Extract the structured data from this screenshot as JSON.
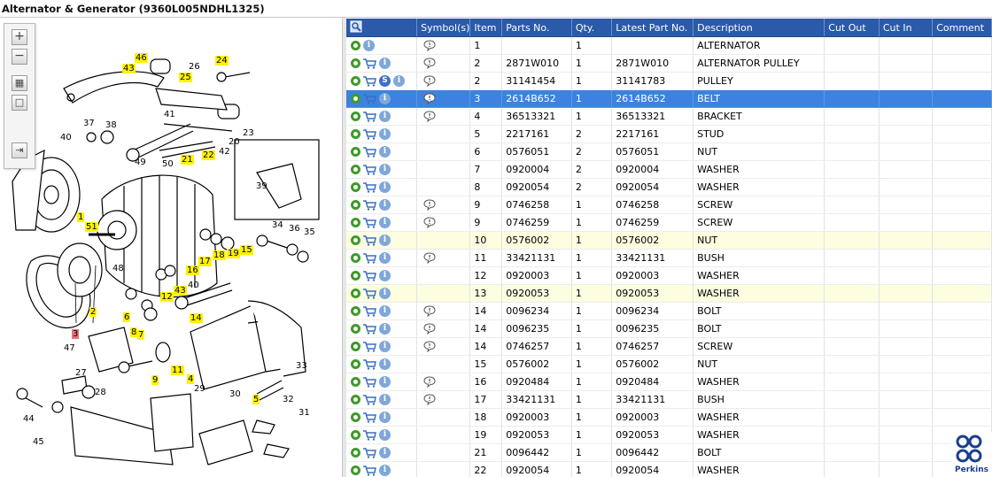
{
  "window": {
    "title": "Alternator & Generator (9360L005NDHL1325)"
  },
  "toolbar": {
    "zoom_in": "+",
    "zoom_out": "−",
    "fit": "▦",
    "actual": "□",
    "export": "⇥"
  },
  "callouts": [
    {
      "text": "46",
      "style": "hl"
    },
    {
      "text": "43",
      "style": "hl"
    },
    {
      "text": "26",
      "style": ""
    },
    {
      "text": "24",
      "style": "hl"
    },
    {
      "text": "25",
      "style": "hl"
    },
    {
      "text": "41",
      "style": ""
    },
    {
      "text": "37",
      "style": ""
    },
    {
      "text": "38",
      "style": ""
    },
    {
      "text": "40",
      "style": ""
    },
    {
      "text": "49",
      "style": ""
    },
    {
      "text": "50",
      "style": ""
    },
    {
      "text": "21",
      "style": "hl"
    },
    {
      "text": "22",
      "style": "hl"
    },
    {
      "text": "42",
      "style": ""
    },
    {
      "text": "20",
      "style": ""
    },
    {
      "text": "23",
      "style": ""
    },
    {
      "text": "39",
      "style": ""
    },
    {
      "text": "1",
      "style": "hl"
    },
    {
      "text": "51",
      "style": "hl"
    },
    {
      "text": "34",
      "style": ""
    },
    {
      "text": "36",
      "style": ""
    },
    {
      "text": "35",
      "style": ""
    },
    {
      "text": "18",
      "style": "hl"
    },
    {
      "text": "19",
      "style": "hl"
    },
    {
      "text": "15",
      "style": "hl"
    },
    {
      "text": "17",
      "style": "hl"
    },
    {
      "text": "16",
      "style": "hl"
    },
    {
      "text": "40",
      "style": ""
    },
    {
      "text": "48",
      "style": ""
    },
    {
      "text": "43",
      "style": "hl"
    },
    {
      "text": "12",
      "style": "hl"
    },
    {
      "text": "2",
      "style": "hl"
    },
    {
      "text": "14",
      "style": "hl"
    },
    {
      "text": "6",
      "style": "hl"
    },
    {
      "text": "8",
      "style": "hl"
    },
    {
      "text": "7",
      "style": "hl"
    },
    {
      "text": "3",
      "style": "sel"
    },
    {
      "text": "47",
      "style": ""
    },
    {
      "text": "33",
      "style": ""
    },
    {
      "text": "11",
      "style": "hl"
    },
    {
      "text": "9",
      "style": "hl"
    },
    {
      "text": "4",
      "style": "hl"
    },
    {
      "text": "27",
      "style": ""
    },
    {
      "text": "28",
      "style": ""
    },
    {
      "text": "29",
      "style": ""
    },
    {
      "text": "30",
      "style": ""
    },
    {
      "text": "5",
      "style": "hl"
    },
    {
      "text": "32",
      "style": ""
    },
    {
      "text": "44",
      "style": ""
    },
    {
      "text": "45",
      "style": ""
    },
    {
      "text": "31",
      "style": ""
    }
  ],
  "columns": [
    "",
    "Symbol(s)",
    "Item",
    "Parts No.",
    "Qty.",
    "Latest Part No.",
    "Description",
    "Cut Out",
    "Cut In",
    "Comment"
  ],
  "rows": [
    {
      "cart": false,
      "s": false,
      "note": true,
      "item": "1",
      "part": "",
      "qty": "1",
      "latest": "",
      "desc": "ALTERNATOR",
      "state": ""
    },
    {
      "cart": true,
      "s": false,
      "note": true,
      "item": "2",
      "part": "2871W010",
      "qty": "1",
      "latest": "2871W010",
      "desc": "ALTERNATOR PULLEY",
      "state": ""
    },
    {
      "cart": true,
      "s": true,
      "note": true,
      "item": "2",
      "part": "31141454",
      "qty": "1",
      "latest": "31141783",
      "desc": "PULLEY",
      "state": ""
    },
    {
      "cart": true,
      "s": false,
      "note": true,
      "item": "3",
      "part": "2614B652",
      "qty": "1",
      "latest": "2614B652",
      "desc": "BELT",
      "state": "sel"
    },
    {
      "cart": true,
      "s": false,
      "note": true,
      "item": "4",
      "part": "36513321",
      "qty": "1",
      "latest": "36513321",
      "desc": "BRACKET",
      "state": ""
    },
    {
      "cart": true,
      "s": false,
      "note": false,
      "item": "5",
      "part": "2217161",
      "qty": "2",
      "latest": "2217161",
      "desc": "STUD",
      "state": ""
    },
    {
      "cart": true,
      "s": false,
      "note": false,
      "item": "6",
      "part": "0576051",
      "qty": "2",
      "latest": "0576051",
      "desc": "NUT",
      "state": ""
    },
    {
      "cart": true,
      "s": false,
      "note": false,
      "item": "7",
      "part": "0920004",
      "qty": "2",
      "latest": "0920004",
      "desc": "WASHER",
      "state": ""
    },
    {
      "cart": true,
      "s": false,
      "note": false,
      "item": "8",
      "part": "0920054",
      "qty": "2",
      "latest": "0920054",
      "desc": "WASHER",
      "state": ""
    },
    {
      "cart": true,
      "s": false,
      "note": true,
      "item": "9",
      "part": "0746258",
      "qty": "1",
      "latest": "0746258",
      "desc": "SCREW",
      "state": ""
    },
    {
      "cart": true,
      "s": false,
      "note": true,
      "item": "9",
      "part": "0746259",
      "qty": "1",
      "latest": "0746259",
      "desc": "SCREW",
      "state": ""
    },
    {
      "cart": true,
      "s": false,
      "note": false,
      "item": "10",
      "part": "0576002",
      "qty": "1",
      "latest": "0576002",
      "desc": "NUT",
      "state": "hl"
    },
    {
      "cart": true,
      "s": false,
      "note": true,
      "item": "11",
      "part": "33421131",
      "qty": "1",
      "latest": "33421131",
      "desc": "BUSH",
      "state": ""
    },
    {
      "cart": true,
      "s": false,
      "note": false,
      "item": "12",
      "part": "0920003",
      "qty": "1",
      "latest": "0920003",
      "desc": "WASHER",
      "state": ""
    },
    {
      "cart": true,
      "s": false,
      "note": false,
      "item": "13",
      "part": "0920053",
      "qty": "1",
      "latest": "0920053",
      "desc": "WASHER",
      "state": "hl"
    },
    {
      "cart": true,
      "s": false,
      "note": true,
      "item": "14",
      "part": "0096234",
      "qty": "1",
      "latest": "0096234",
      "desc": "BOLT",
      "state": ""
    },
    {
      "cart": true,
      "s": false,
      "note": true,
      "item": "14",
      "part": "0096235",
      "qty": "1",
      "latest": "0096235",
      "desc": "BOLT",
      "state": ""
    },
    {
      "cart": true,
      "s": false,
      "note": true,
      "item": "14",
      "part": "0746257",
      "qty": "1",
      "latest": "0746257",
      "desc": "SCREW",
      "state": ""
    },
    {
      "cart": true,
      "s": false,
      "note": false,
      "item": "15",
      "part": "0576002",
      "qty": "1",
      "latest": "0576002",
      "desc": "NUT",
      "state": ""
    },
    {
      "cart": true,
      "s": false,
      "note": true,
      "item": "16",
      "part": "0920484",
      "qty": "1",
      "latest": "0920484",
      "desc": "WASHER",
      "state": ""
    },
    {
      "cart": true,
      "s": false,
      "note": true,
      "item": "17",
      "part": "33421131",
      "qty": "1",
      "latest": "33421131",
      "desc": "BUSH",
      "state": ""
    },
    {
      "cart": true,
      "s": false,
      "note": false,
      "item": "18",
      "part": "0920003",
      "qty": "1",
      "latest": "0920003",
      "desc": "WASHER",
      "state": ""
    },
    {
      "cart": true,
      "s": false,
      "note": false,
      "item": "19",
      "part": "0920053",
      "qty": "1",
      "latest": "0920053",
      "desc": "WASHER",
      "state": ""
    },
    {
      "cart": true,
      "s": false,
      "note": false,
      "item": "21",
      "part": "0096442",
      "qty": "1",
      "latest": "0096442",
      "desc": "BOLT",
      "state": ""
    },
    {
      "cart": true,
      "s": false,
      "note": false,
      "item": "22",
      "part": "0920054",
      "qty": "1",
      "latest": "0920054",
      "desc": "WASHER",
      "state": ""
    }
  ],
  "logo": {
    "text": "Perkins",
    "brand_color": "#1b3f8e"
  },
  "colors": {
    "header": "#2a5aa8",
    "selected_row": "#3d82e0",
    "callout_highlight": "#fff200",
    "callout_selected": "#e8737a"
  }
}
